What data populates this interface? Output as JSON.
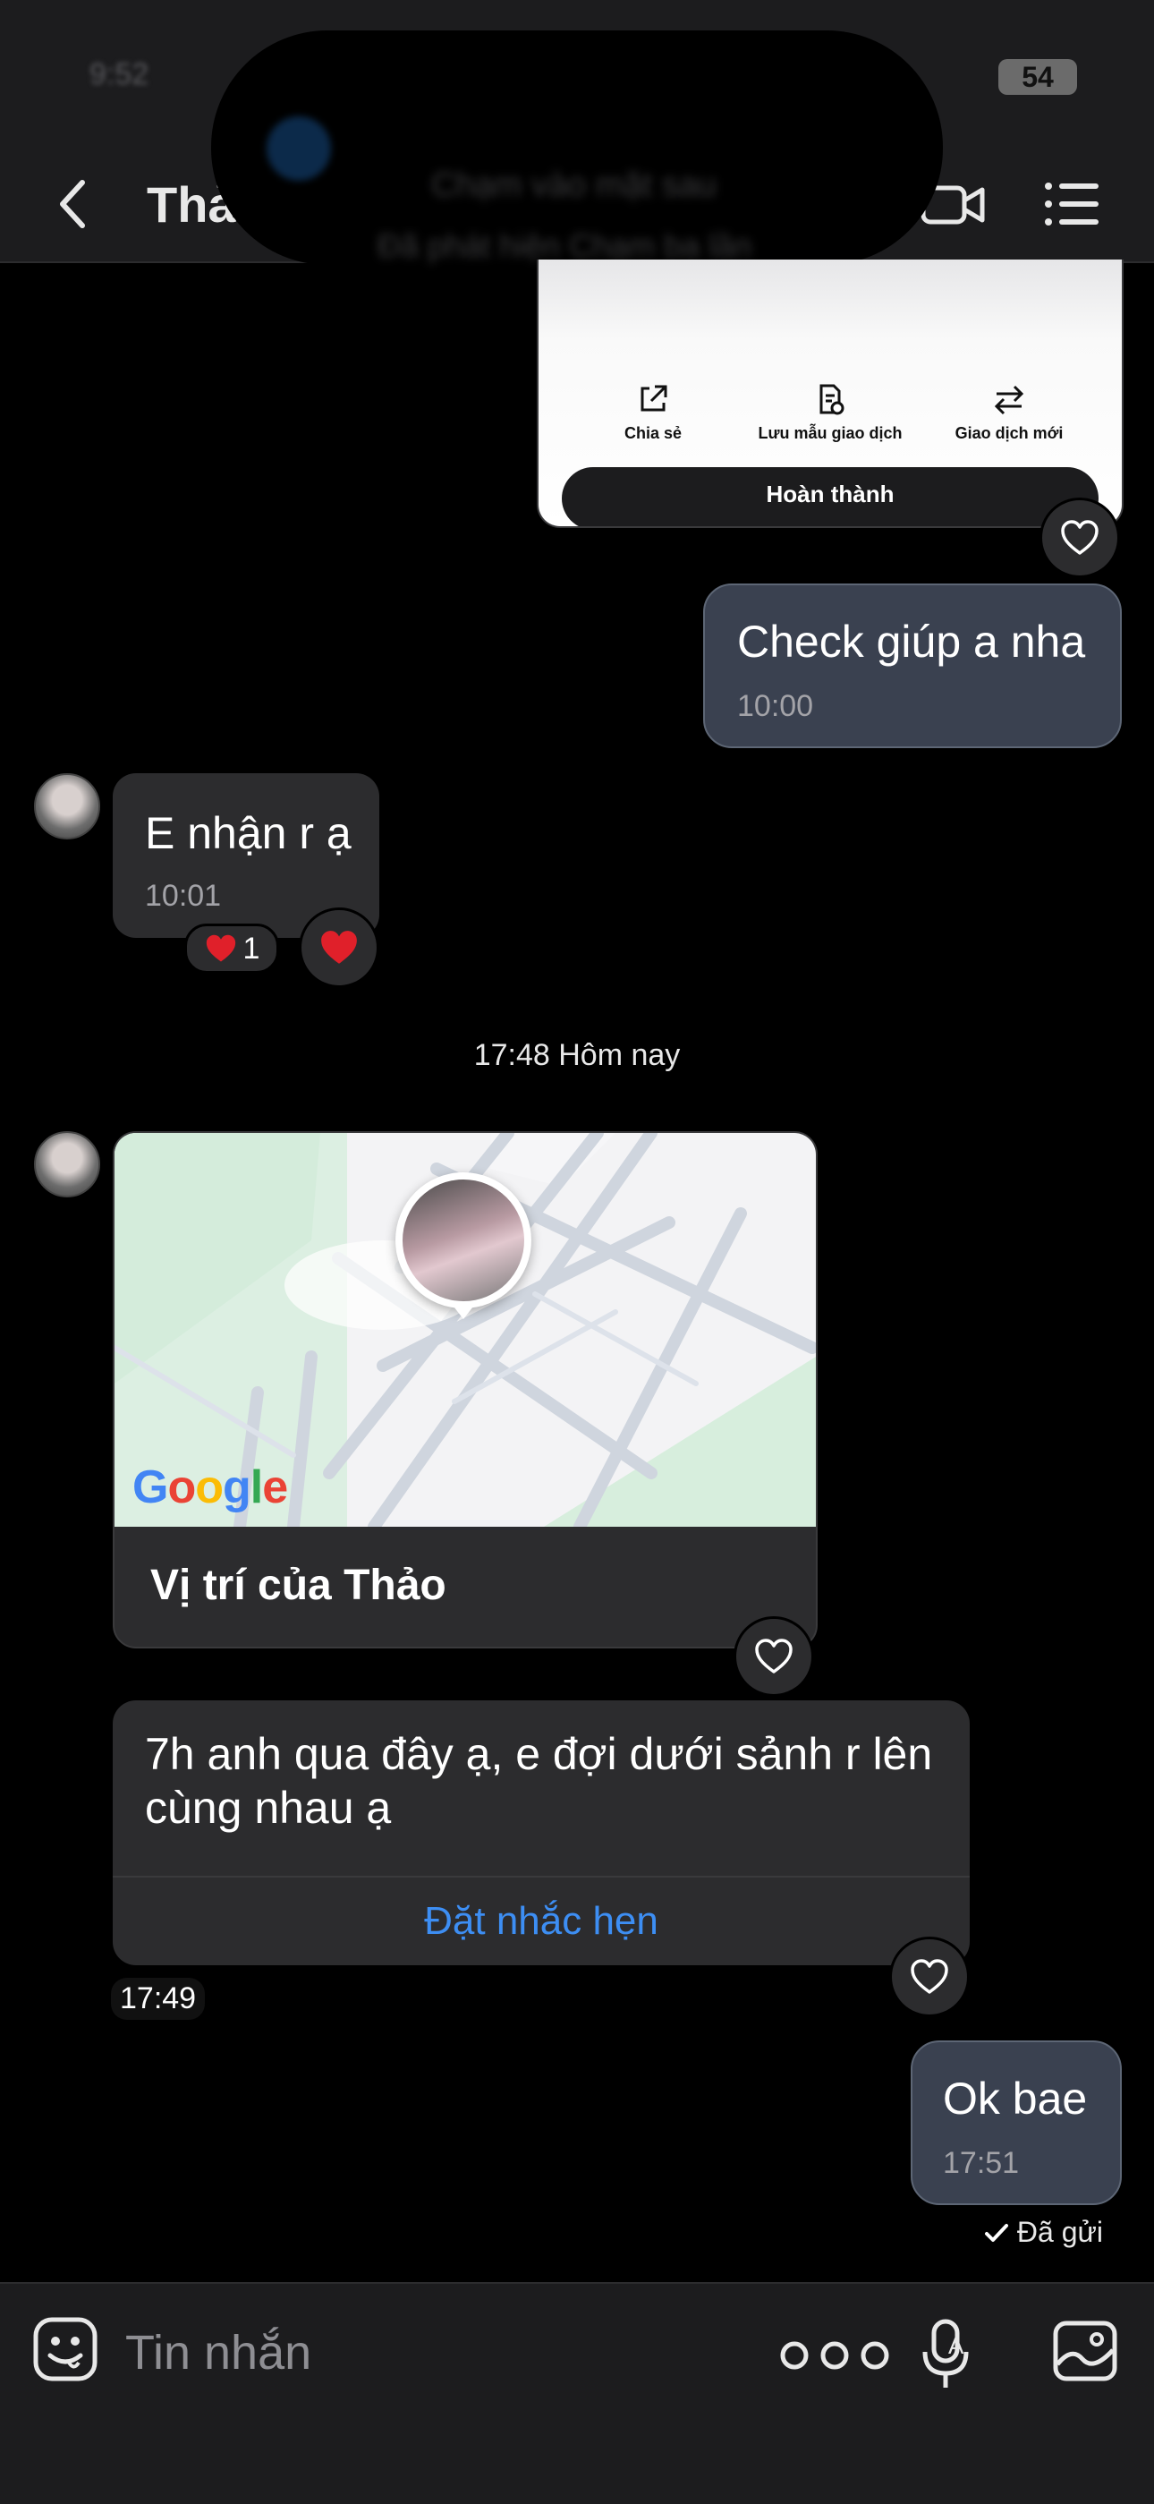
{
  "status_bar": {
    "time": "9:52",
    "battery": "54"
  },
  "header": {
    "contact_name": "Thả",
    "back_icon": "chevron-left-icon",
    "video_icon": "video-camera-icon",
    "menu_icon": "list-menu-icon"
  },
  "notification": {
    "title": "Chạm vào mặt sau",
    "subtitle": "Đã phát hiện Chạm ba lần"
  },
  "receipt_card": {
    "actions": [
      {
        "label": "Chia sẻ",
        "icon": "share-icon"
      },
      {
        "label": "Lưu mẫu giao dịch",
        "icon": "document-save-icon"
      },
      {
        "label": "Giao dịch mới",
        "icon": "arrows-swap-icon"
      }
    ],
    "done_label": "Hoàn thành"
  },
  "messages": [
    {
      "from": "me",
      "text": "Check giúp a nha",
      "time": "10:00"
    },
    {
      "from": "contact",
      "text": "E nhận r ạ",
      "time": "10:01",
      "reaction_count": "1"
    }
  ],
  "separator": {
    "label": "17:48 Hôm nay"
  },
  "location": {
    "label": "Vị trí của Thảo",
    "provider": "Google"
  },
  "reminder_message": {
    "text": "7h anh qua đây ạ, e đợi dưới sảnh r lên cùng nhau ạ",
    "action": "Đặt nhắc hẹn",
    "time": "17:49"
  },
  "last_message": {
    "text": "Ok bae",
    "time": "17:51",
    "status": "Đã gửi"
  },
  "composer": {
    "placeholder": "Tin nhắn"
  },
  "colors": {
    "accent": "#3d8ef3",
    "outgoing_bubble": "#3a4150",
    "incoming_bubble": "#2c2c2e",
    "heart": "#e0202a"
  }
}
